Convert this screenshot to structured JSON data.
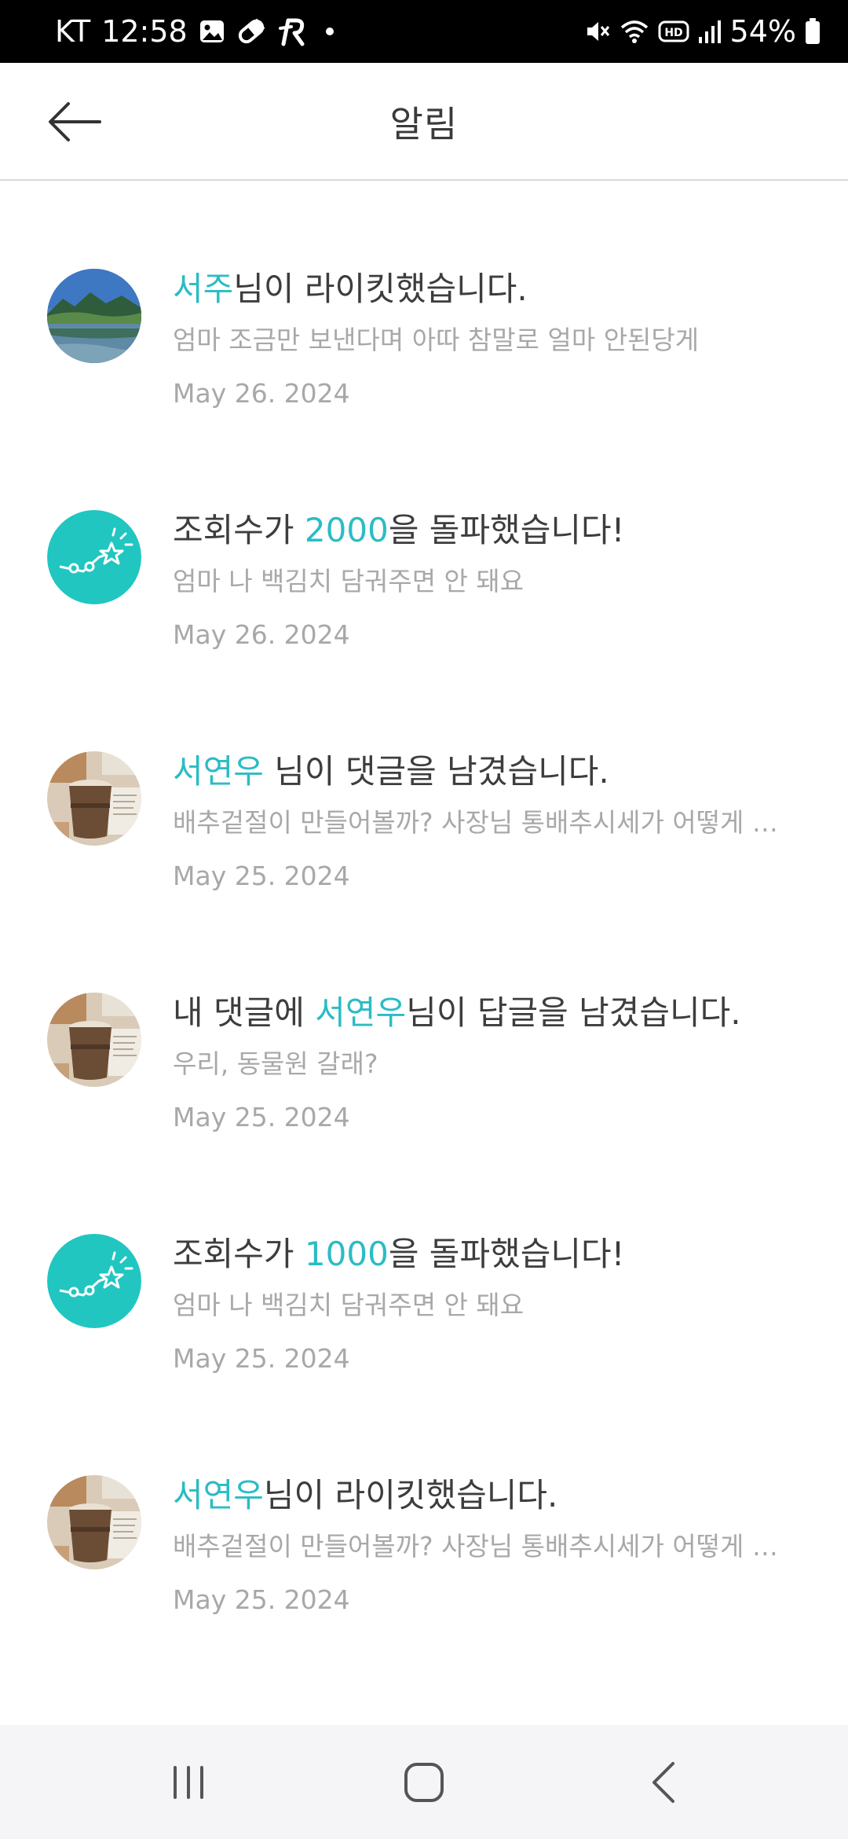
{
  "status_bar": {
    "carrier": "KT",
    "time": "12:58",
    "battery": "54%",
    "left_icons": [
      "gallery-icon",
      "pill-icon",
      "r-app-icon",
      "notification-dot-icon"
    ],
    "right_icons": [
      "mute-icon",
      "wifi-icon",
      "hd-icon",
      "signal-icon",
      "battery-icon"
    ]
  },
  "header": {
    "title": "알림",
    "back_icon": "arrow-left-icon"
  },
  "colors": {
    "accent": "#2bbcc4",
    "title_text": "#3d3d3d",
    "secondary_text": "#a8a8a8",
    "teal_avatar": "#21c6c1"
  },
  "notifications": [
    {
      "avatar": "landscape-photo",
      "title_parts": [
        "서주",
        "님이 라이킷했습니다.",
        ""
      ],
      "preview": "엄마 조금만 보낸다며 아따 참말로 얼마 안된당게",
      "date": "May 26. 2024"
    },
    {
      "avatar": "views-milestone-icon",
      "title_parts": [
        "조회수가 ",
        "2000",
        "을 돌파했습니다!"
      ],
      "preview": "엄마 나 백김치 담궈주면 안 돼요",
      "date": "May 26. 2024"
    },
    {
      "avatar": "coffee-cup-photo",
      "title_parts": [
        "서연우",
        " 님이 댓글을 남겼습니다.",
        ""
      ],
      "preview": "배추겉절이 만들어볼까? 사장님 통배추시세가 어떻게 …",
      "date": "May 25. 2024"
    },
    {
      "avatar": "coffee-cup-photo",
      "title_parts": [
        "내 댓글에 ",
        "서연우",
        "님이 답글을 남겼습니다."
      ],
      "preview": "우리, 동물원 갈래?",
      "date": "May 25. 2024"
    },
    {
      "avatar": "views-milestone-icon",
      "title_parts": [
        "조회수가 ",
        "1000",
        "을 돌파했습니다!"
      ],
      "preview": "엄마 나 백김치 담궈주면 안 돼요",
      "date": "May 25. 2024"
    },
    {
      "avatar": "coffee-cup-photo",
      "title_parts": [
        "서연우",
        "님이 라이킷했습니다.",
        ""
      ],
      "preview": "배추겉절이 만들어볼까? 사장님 통배추시세가 어떻게 …",
      "date": "May 25. 2024"
    }
  ],
  "nav_bar": {
    "recents_icon": "recent-apps-icon",
    "home_icon": "home-icon",
    "back_icon": "back-chevron-icon"
  }
}
